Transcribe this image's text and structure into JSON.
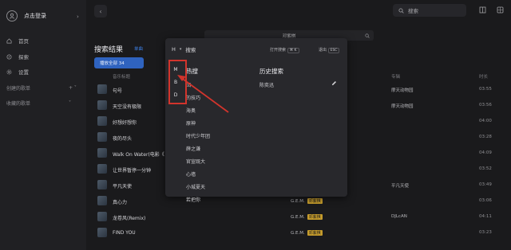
{
  "user": {
    "name": "点击登录"
  },
  "sidebar": {
    "items": [
      {
        "label": "首页",
        "icon": "home-icon"
      },
      {
        "label": "探索",
        "icon": "compass-icon"
      },
      {
        "label": "设置",
        "icon": "gear-icon"
      }
    ],
    "created_label": "创建的歌单",
    "created_tail": "+  ˅",
    "favorites_label": "收藏的歌单",
    "favorites_tail": "˅"
  },
  "topbar": {
    "search_placeholder": "搜索"
  },
  "main": {
    "query": "邓紫棋",
    "title": "搜索结果",
    "tab": "单曲",
    "play_all": "播放全部 34",
    "columns": {
      "title": "音乐标题",
      "album": "专辑",
      "duration": "时长"
    }
  },
  "songs": [
    {
      "title": "句号",
      "artist": "",
      "tag": "",
      "album": "摩天动物园",
      "duration": "03:55"
    },
    {
      "title": "天空没有极限",
      "artist": "",
      "tag": "",
      "album": "摩天动物园",
      "duration": "03:56"
    },
    {
      "title": "好想好想你",
      "artist": "",
      "tag": "",
      "album": "",
      "duration": "04:00"
    },
    {
      "title": "夜的尽头",
      "artist": "",
      "tag": "",
      "album": "",
      "duration": "03:28"
    },
    {
      "title": "Walk On Water(电影《",
      "artist": "",
      "tag": "",
      "album": "",
      "duration": "04:09"
    },
    {
      "title": "让世界暂停一分钟",
      "artist": "",
      "tag": "",
      "album": "",
      "duration": "03:52"
    },
    {
      "title": "平凡天使",
      "artist": "",
      "tag": "",
      "album": "平凡天使",
      "duration": "03:49"
    },
    {
      "title": "真心力",
      "artist": "G.E.M.",
      "tag": "邓紫棋",
      "album": "",
      "duration": "03:06"
    },
    {
      "title": "龙卷风(Remix)",
      "artist": "G.E.M.",
      "tag": "邓紫棋",
      "album": "DJLcAN",
      "duration": "04:11"
    },
    {
      "title": "FIND YOU",
      "artist": "G.E.M.",
      "tag": "邓紫棋",
      "album": "",
      "duration": "03:23"
    }
  ],
  "dropdown": {
    "source": "H",
    "source_label": "搜索",
    "open_label": "打开搜索",
    "open_key": "⌘ K",
    "exit_label": "退出",
    "exit_key": "ESC",
    "side_options": [
      "M",
      "B",
      "D"
    ],
    "hot_title": "热搜",
    "hot_items": [
      "回",
      "的技巧",
      "海奥",
      "原神",
      "时代少年团",
      "薛之谦",
      "官宣既大",
      "心墙",
      "小城夏天",
      "若把你"
    ],
    "history_title": "历史搜索",
    "history_item": "陈奕迅"
  }
}
